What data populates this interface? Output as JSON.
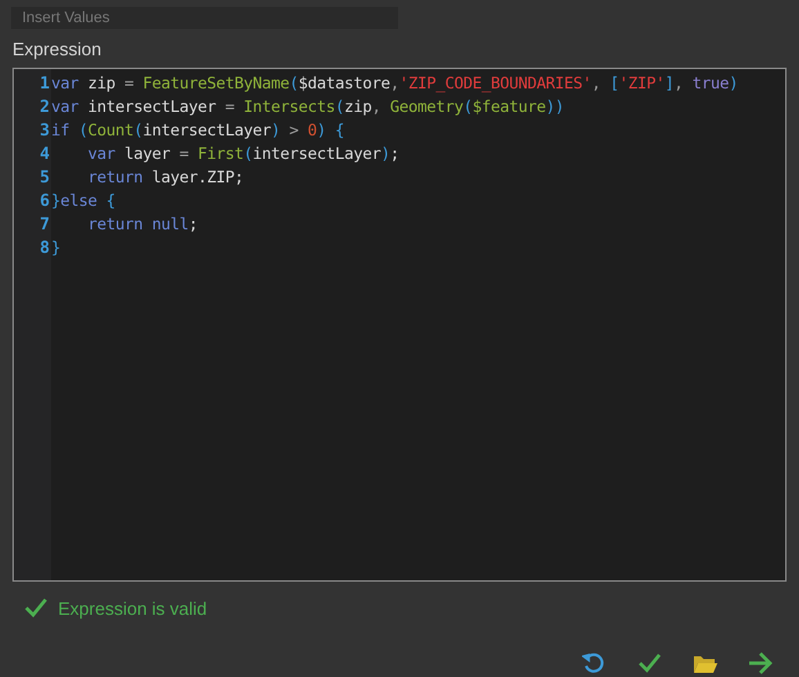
{
  "insert_values": {
    "placeholder": "Insert Values"
  },
  "expression_label": "Expression",
  "code_lines": [
    {
      "number": "1",
      "tokens": [
        {
          "t": "var",
          "color": "#6a86d6"
        },
        {
          "t": " zip ",
          "color": "#d8d8d8"
        },
        {
          "t": "= ",
          "color": "#9a9a9a"
        },
        {
          "t": "FeatureSetByName",
          "color": "#8fb33a"
        },
        {
          "t": "(",
          "color": "#3d9ad8"
        },
        {
          "t": "$datastore",
          "color": "#d8d8d8"
        },
        {
          "t": ",",
          "color": "#9a9a9a"
        },
        {
          "t": "'ZIP_CODE_BOUNDARIES'",
          "color": "#e03c3c"
        },
        {
          "t": ", ",
          "color": "#9a9a9a"
        },
        {
          "t": "[",
          "color": "#3d9ad8"
        },
        {
          "t": "'ZIP'",
          "color": "#e03c3c"
        },
        {
          "t": "]",
          "color": "#3d9ad8"
        },
        {
          "t": ", ",
          "color": "#9a9a9a"
        },
        {
          "t": "true",
          "color": "#8a7fd0"
        },
        {
          "t": ")",
          "color": "#3d9ad8"
        }
      ]
    },
    {
      "number": "2",
      "tokens": [
        {
          "t": "var",
          "color": "#6a86d6"
        },
        {
          "t": " intersectLayer ",
          "color": "#d8d8d8"
        },
        {
          "t": "= ",
          "color": "#9a9a9a"
        },
        {
          "t": "Intersects",
          "color": "#8fb33a"
        },
        {
          "t": "(",
          "color": "#3d9ad8"
        },
        {
          "t": "zip",
          "color": "#d8d8d8"
        },
        {
          "t": ", ",
          "color": "#9a9a9a"
        },
        {
          "t": "Geometry",
          "color": "#8fb33a"
        },
        {
          "t": "(",
          "color": "#3d9ad8"
        },
        {
          "t": "$feature",
          "color": "#8fb33a"
        },
        {
          "t": "))",
          "color": "#3d9ad8"
        }
      ]
    },
    {
      "number": "3",
      "tokens": [
        {
          "t": "if ",
          "color": "#6a86d6"
        },
        {
          "t": "(",
          "color": "#3d9ad8"
        },
        {
          "t": "Count",
          "color": "#8fb33a"
        },
        {
          "t": "(",
          "color": "#3d9ad8"
        },
        {
          "t": "intersectLayer",
          "color": "#d8d8d8"
        },
        {
          "t": ")",
          "color": "#3d9ad8"
        },
        {
          "t": " > ",
          "color": "#9a9a9a"
        },
        {
          "t": "0",
          "color": "#d05030"
        },
        {
          "t": ") {",
          "color": "#3d9ad8"
        }
      ]
    },
    {
      "number": "4",
      "tokens": [
        {
          "t": "    var",
          "color": "#6a86d6"
        },
        {
          "t": " layer ",
          "color": "#d8d8d8"
        },
        {
          "t": "= ",
          "color": "#9a9a9a"
        },
        {
          "t": "First",
          "color": "#8fb33a"
        },
        {
          "t": "(",
          "color": "#3d9ad8"
        },
        {
          "t": "intersectLayer",
          "color": "#d8d8d8"
        },
        {
          "t": ")",
          "color": "#3d9ad8"
        },
        {
          "t": ";",
          "color": "#d8d8d8"
        }
      ]
    },
    {
      "number": "5",
      "tokens": [
        {
          "t": "    return",
          "color": "#6a86d6"
        },
        {
          "t": " layer.ZIP;",
          "color": "#d8d8d8"
        }
      ]
    },
    {
      "number": "6",
      "tokens": [
        {
          "t": "}",
          "color": "#3d9ad8"
        },
        {
          "t": "else",
          "color": "#6a86d6"
        },
        {
          "t": " {",
          "color": "#3d9ad8"
        }
      ]
    },
    {
      "number": "7",
      "tokens": [
        {
          "t": "    return null",
          "color": "#6a86d6"
        },
        {
          "t": ";",
          "color": "#d8d8d8"
        }
      ]
    },
    {
      "number": "8",
      "tokens": [
        {
          "t": "}",
          "color": "#3d9ad8"
        }
      ]
    }
  ],
  "status": {
    "text": "Expression is valid",
    "valid": true
  }
}
